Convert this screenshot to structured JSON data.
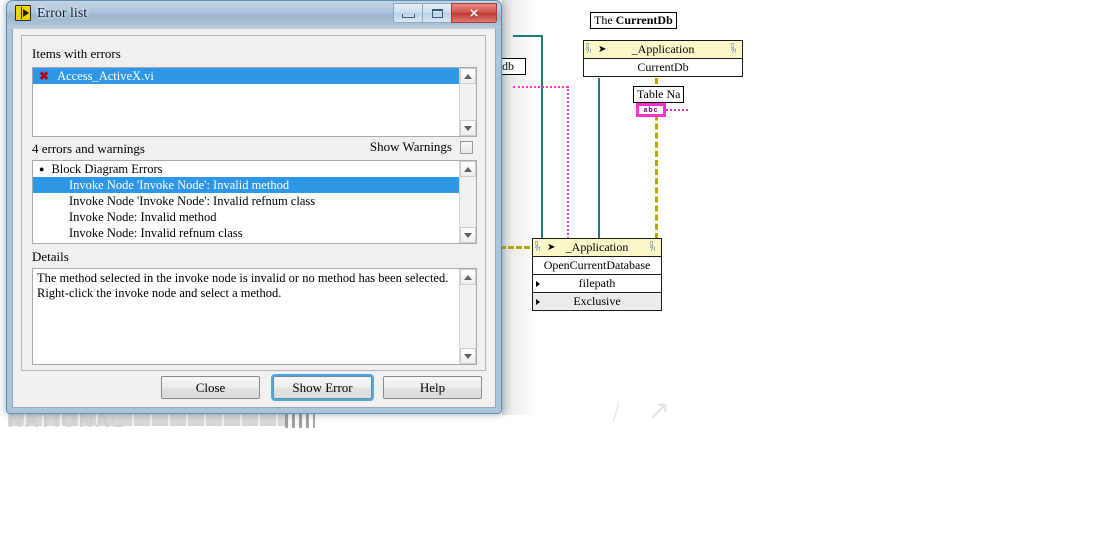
{
  "window": {
    "title": "Error list",
    "icon": "labview-vi-icon",
    "controls": {
      "minimize": "minimize-icon",
      "maximize": "maximize-icon",
      "close": "×"
    }
  },
  "dialog": {
    "items_with_errors_label": "Items with errors",
    "items": [
      {
        "icon": "✖",
        "label": "Access_ActiveX.vi",
        "selected": true
      }
    ],
    "errors_summary": "4 errors and warnings",
    "show_warnings_label": "Show Warnings",
    "show_warnings_checked": false,
    "error_rows": [
      {
        "label": "Block Diagram Errors",
        "type": "group",
        "selected": false
      },
      {
        "label": "Invoke Node 'Invoke Node': Invalid method",
        "type": "item",
        "selected": true
      },
      {
        "label": "Invoke Node 'Invoke Node': Invalid refnum class",
        "type": "item",
        "selected": false
      },
      {
        "label": "Invoke Node: Invalid method",
        "type": "item",
        "selected": false
      },
      {
        "label": "Invoke Node: Invalid refnum class",
        "type": "item",
        "selected": false
      }
    ],
    "details_label": "Details",
    "details_text": "The method selected in the invoke node is invalid or no method has been selected.\nRight-click the invoke node and select a method.",
    "buttons": {
      "close": "Close",
      "show_error": "Show Error",
      "help": "Help"
    },
    "default_button": "Show Error"
  },
  "block_diagram": {
    "comment_top": "The CurrentDb",
    "comment_top_bold": "CurrentDb",
    "comment_top_plain": "The ",
    "node_top": {
      "header": "_Application",
      "method": "CurrentDb"
    },
    "label_table_name": "Table Na",
    "string_terminal": "abc",
    "hidden_db_label": "db",
    "node_bottom": {
      "header": "_Application",
      "method": "OpenCurrentDatabase",
      "params": [
        {
          "label": "filepath",
          "shaded": false
        },
        {
          "label": "Exclusive",
          "shaded": true
        }
      ]
    }
  },
  "watermark": {
    "text": "NATIONAL"
  },
  "colors": {
    "selection_blue": "#2e97e8",
    "error_red": "#b00018",
    "node_header_yellow": "#fbf7c8",
    "wire_pink": "#ff2fd0",
    "wire_teal": "#1f7a7a",
    "wire_yellow": "#cfc100",
    "default_button_glow": "#4ba9e0",
    "dialog_face": "#f0f0f0"
  }
}
